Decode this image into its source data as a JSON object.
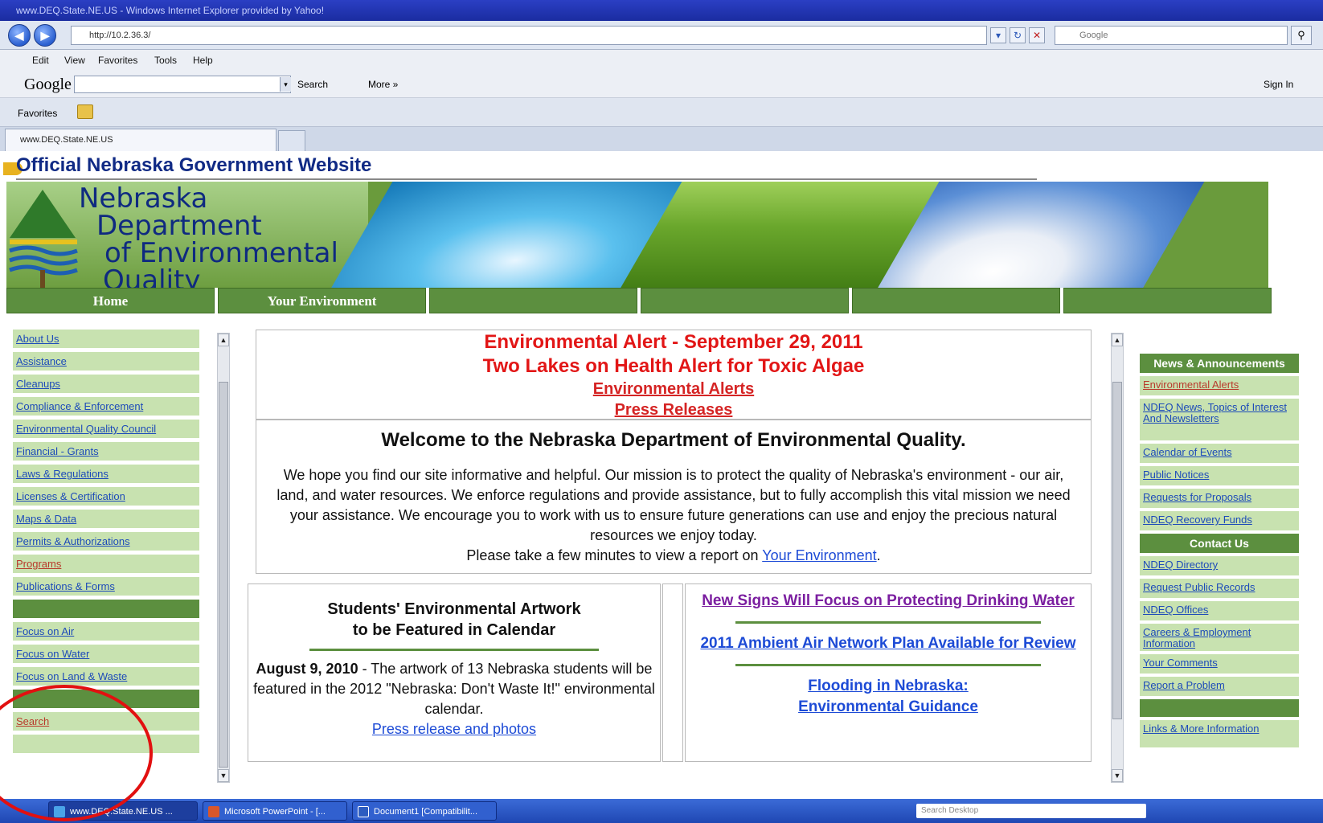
{
  "window": {
    "title": "www.DEQ.State.NE.US - Windows Internet Explorer provided by Yahoo!"
  },
  "address_bar": {
    "url": "http://10.2.36.3/",
    "search_placeholder": "Google"
  },
  "menu": [
    "Edit",
    "View",
    "Favorites",
    "Tools",
    "Help"
  ],
  "google_toolbar": {
    "logo": "Google",
    "search_label": "Search",
    "more_label": "More »",
    "sign_in_label": "Sign In"
  },
  "favorites_bar": {
    "label": "Favorites"
  },
  "tab": {
    "title": "www.DEQ.State.NE.US"
  },
  "page": {
    "official_title": "Official Nebraska Government Website",
    "banner_title": [
      "Nebraska",
      "Department",
      "of Environmental",
      "Quality"
    ],
    "nav": [
      "Home",
      "Your Environment",
      "",
      "",
      "",
      ""
    ],
    "left_nav": {
      "group1": [
        "About Us",
        "Assistance",
        "Cleanups",
        "Compliance & Enforcement",
        "Environmental Quality Council",
        "Financial - Grants",
        "Laws & Regulations",
        "Licenses & Certification",
        "Maps & Data",
        "Permits & Authorizations",
        "Programs",
        "Publications & Forms"
      ],
      "group2": [
        "Focus on Air",
        "Focus on Water",
        "Focus on Land & Waste"
      ],
      "group3": [
        "Search"
      ]
    },
    "alert": {
      "line1": "Environmental Alert - September 29, 2011",
      "line2": "Two Lakes on Health Alert for Toxic Algae",
      "link1": "Environmental Alerts",
      "link2": "Press Releases"
    },
    "welcome": {
      "title": "Welcome to the Nebraska Department of Environmental Quality.",
      "body": "We hope you find our site informative and helpful. Our mission is to protect the quality of Nebraska's environment - our air, land, and water resources. We enforce regulations and provide assistance, but to fully accomplish this vital mission we need your assistance. We encourage you to work with us to ensure future generations can use and enjoy the precious natural resources we enjoy today.",
      "cta_prefix": "Please take a few minutes to view a report on",
      "cta_link": "Your Environment",
      "cta_suffix": "."
    },
    "artwork": {
      "title_line1": "Students' Environmental Artwork",
      "title_line2": "to be Featured in Calendar",
      "date": "August 9, 2010",
      "body": " - The artwork of 13 Nebraska students will be featured in the 2012 \"Nebraska: Don't Waste It!\" environmental calendar.",
      "link": "Press release and photos"
    },
    "news_items": [
      "New Signs Will Focus on Protecting Drinking Water",
      "2011 Ambient Air Network Plan Available for Review",
      "Flooding in Nebraska: Environmental Guidance"
    ],
    "right_nav": {
      "news_header": "News & Announcements",
      "news_links": [
        "Environmental Alerts",
        "NDEQ News, Topics of Interest And Newsletters",
        "Calendar of Events",
        "Public Notices",
        "Requests for Proposals",
        "NDEQ Recovery Funds"
      ],
      "contact_header": "Contact Us",
      "contact_links": [
        "NDEQ Directory",
        "Request Public Records",
        "NDEQ Offices",
        "Careers & Employment Information",
        "Your Comments",
        "Report a Problem"
      ],
      "more_link": "Links & More Information"
    }
  },
  "taskbar": {
    "items": [
      "www.DEQ.State.NE.US ...",
      "Microsoft PowerPoint - [...",
      "Document1 [Compatibilit..."
    ],
    "search_placeholder": "Search Desktop"
  },
  "colors": {
    "nav_green": "#5c8f3f",
    "link_blue": "#1d4bb9",
    "alert_red": "#e21616",
    "annotation_red": "#e21010"
  }
}
